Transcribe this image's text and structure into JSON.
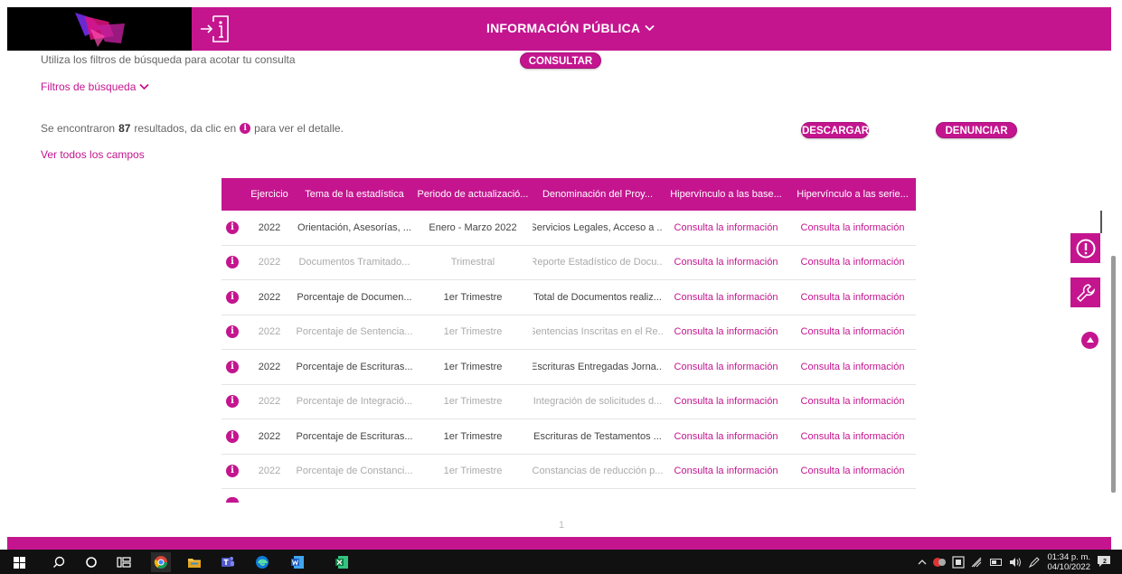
{
  "header": {
    "title": "INFORMACIÓN PÚBLICA"
  },
  "search": {
    "hint": "Utiliza los filtros de búsqueda para acotar tu consulta",
    "consult_label": "CONSULTAR",
    "filters_label": "Filtros de búsqueda"
  },
  "results": {
    "prefix": "Se encontraron",
    "count": "87",
    "suffix_before_icon": "resultados, da clic en",
    "suffix_after_icon": "para ver el detalle.",
    "download_label": "DESCARGAR",
    "report_label": "DENUNCIAR",
    "all_fields_label": "Ver todos los campos"
  },
  "table": {
    "columns": [
      "Ejercicio",
      "Tema de la estadística",
      "Periodo de actualizació...",
      "Denominación del Proy...",
      "Hipervínculo a las base...",
      "Hipervínculo a las serie..."
    ],
    "rows": [
      {
        "year": "2022",
        "theme": "Orientación, Asesorías, ...",
        "period": "Enero - Marzo 2022",
        "project": "Servicios Legales, Acceso a ...",
        "link1": "Consulta la información",
        "link2": "Consulta la información",
        "style": "dark"
      },
      {
        "year": "2022",
        "theme": "Documentos Tramitado...",
        "period": "Trimestral",
        "project": "Reporte Estadístico de Docu...",
        "link1": "Consulta la información",
        "link2": "Consulta la información",
        "style": "dim"
      },
      {
        "year": "2022",
        "theme": "Porcentaje de Documen...",
        "period": "1er Trimestre",
        "project": "Total de Documentos realiz...",
        "link1": "Consulta la información",
        "link2": "Consulta la información",
        "style": "dark"
      },
      {
        "year": "2022",
        "theme": "Porcentaje de Sentencia...",
        "period": "1er Trimestre",
        "project": "Sentencias Inscritas en el Re...",
        "link1": "Consulta la información",
        "link2": "Consulta la información",
        "style": "dim"
      },
      {
        "year": "2022",
        "theme": "Porcentaje de Escrituras...",
        "period": "1er Trimestre",
        "project": "Escrituras Entregadas Jorna...",
        "link1": "Consulta la información",
        "link2": "Consulta la información",
        "style": "dark"
      },
      {
        "year": "2022",
        "theme": "Porcentaje de Integració...",
        "period": "1er Trimestre",
        "project": "Integración de solicitudes d...",
        "link1": "Consulta la información",
        "link2": "Consulta la información",
        "style": "dim"
      },
      {
        "year": "2022",
        "theme": "Porcentaje de Escrituras...",
        "period": "1er Trimestre",
        "project": "Escrituras de Testamentos ...",
        "link1": "Consulta la información",
        "link2": "Consulta la información",
        "style": "dark"
      },
      {
        "year": "2022",
        "theme": "Porcentaje de Constanci...",
        "period": "1er Trimestre",
        "project": "Constancias de reducción p...",
        "link1": "Consulta la información",
        "link2": "Consulta la información",
        "style": "dim"
      }
    ]
  },
  "pagination": {
    "current": "1"
  },
  "taskbar": {
    "time": "01:34 p. m.",
    "date": "04/10/2022",
    "notification_count": "2"
  },
  "colors": {
    "brand": "#c4158f"
  }
}
